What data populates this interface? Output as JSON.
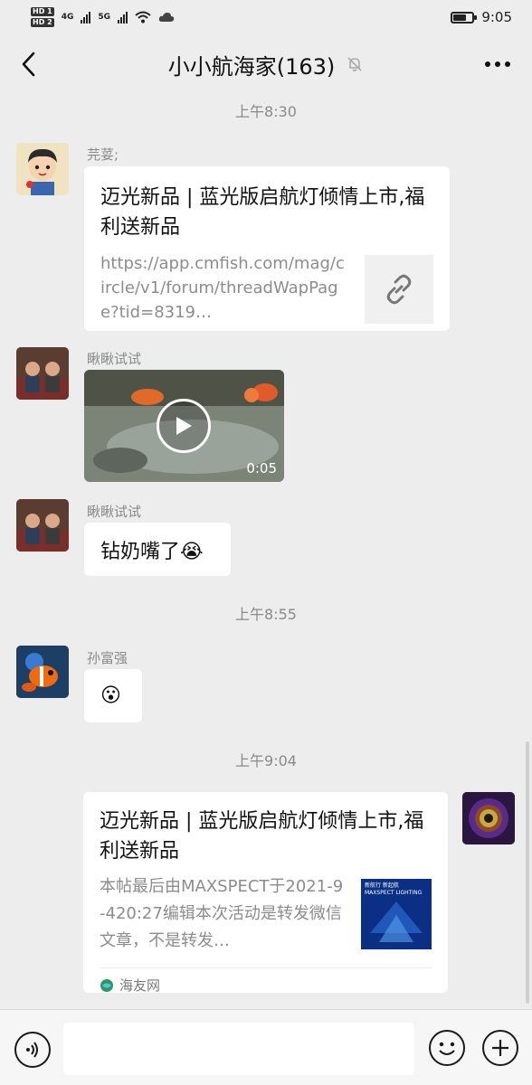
{
  "status_bar": {
    "hd1": "HD 1",
    "hd2": "HD 2",
    "net1": "4G",
    "net2": "5G",
    "time": "9:05",
    "battery_level": 0.7
  },
  "header": {
    "title": "小小航海家(163)",
    "back_icon": "chevron-left-icon",
    "mute_icon": "bell-off-icon",
    "more_icon": "more-horizontal-icon"
  },
  "messages": {
    "time1": "上午8:30",
    "msg1": {
      "sender": "芫荽;",
      "title": "迈光新品 | 蓝光版启航灯倾情上市,福利送新品",
      "url": "https://app.cmfish.com/mag/circle/v1/forum/threadWapPage?tid=8319…",
      "thumb_icon": "link-icon"
    },
    "msg2": {
      "sender": "瞅瞅试试",
      "duration": "0:05",
      "play_icon": "play-icon"
    },
    "msg3": {
      "sender": "瞅瞅试试",
      "text": "钻奶嘴了😭"
    },
    "time2": "上午8:55",
    "msg4": {
      "sender": "孙富强",
      "text": "😮"
    },
    "time3": "上午9:04",
    "msg5": {
      "title": "迈光新品 | 蓝光版启航灯倾情上市,福利送新品",
      "desc": "本帖最后由MAXSPECT于2021-9-420:27编辑本次活动是转发微信文章，不是转发…",
      "thumb_line1": "新航行 新起航",
      "thumb_line2": "MAXSPECT LIGHTING",
      "source": "海友网"
    }
  },
  "input_bar": {
    "voice_icon": "voice-icon",
    "emoji_icon": "emoji-icon",
    "plus_icon": "plus-icon"
  }
}
